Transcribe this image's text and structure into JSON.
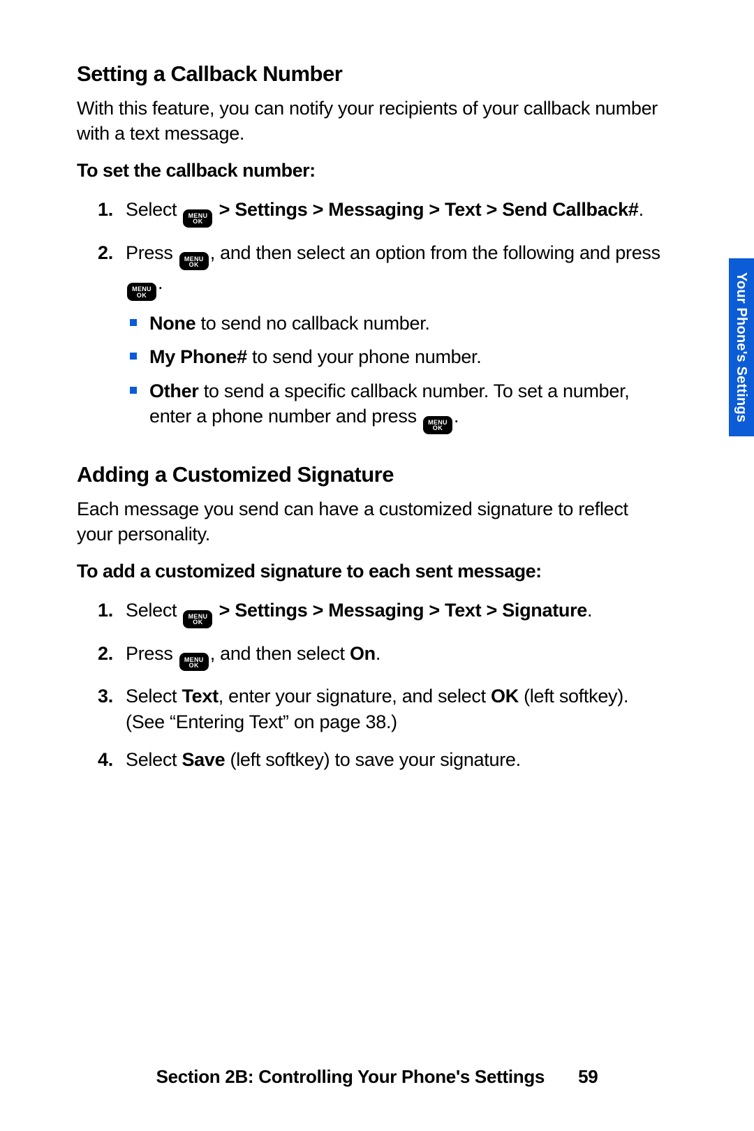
{
  "menu_key": {
    "l1": "MENU",
    "l2": "OK"
  },
  "side_tab": "Your Phone's Settings",
  "section_a": {
    "heading": "Setting a Callback Number",
    "intro": "With this feature, you can notify your recipients of your callback number with a text message.",
    "sub": "To set the callback number:",
    "step1_prefix": "Select ",
    "step1_path": " > Settings > Messaging > Text > Send Callback#",
    "step2_a": "Press ",
    "step2_b": ", and then select an option from the following and press ",
    "bullets": {
      "b1_bold": "None",
      "b1_rest": " to send no callback number.",
      "b2_bold": "My Phone#",
      "b2_rest": " to send your phone number.",
      "b3_bold": "Other",
      "b3_rest_a": " to send a specific callback number. To set a number, enter a phone number and press "
    }
  },
  "section_b": {
    "heading": "Adding a Customized Signature",
    "intro": "Each message you send can have a customized signature to reflect your personality.",
    "sub": "To add a customized signature to each sent message:",
    "step1_prefix": "Select ",
    "step1_path": " > Settings > Messaging > Text > Signature",
    "step2_a": "Press ",
    "step2_b": ", and then select ",
    "step2_on": "On",
    "step3_a": "Select ",
    "step3_text": "Text",
    "step3_b": ", enter your signature, and select ",
    "step3_ok": "OK",
    "step3_c": " (left softkey). (See “Entering Text” on page 38.)",
    "step4_a": "Select ",
    "step4_save": "Save",
    "step4_b": " (left softkey) to save your signature."
  },
  "nums": {
    "n1": "1.",
    "n2": "2.",
    "n3": "3.",
    "n4": "4."
  },
  "footer": {
    "text": "Section 2B: Controlling Your Phone's Settings",
    "page": "59"
  },
  "period": "."
}
